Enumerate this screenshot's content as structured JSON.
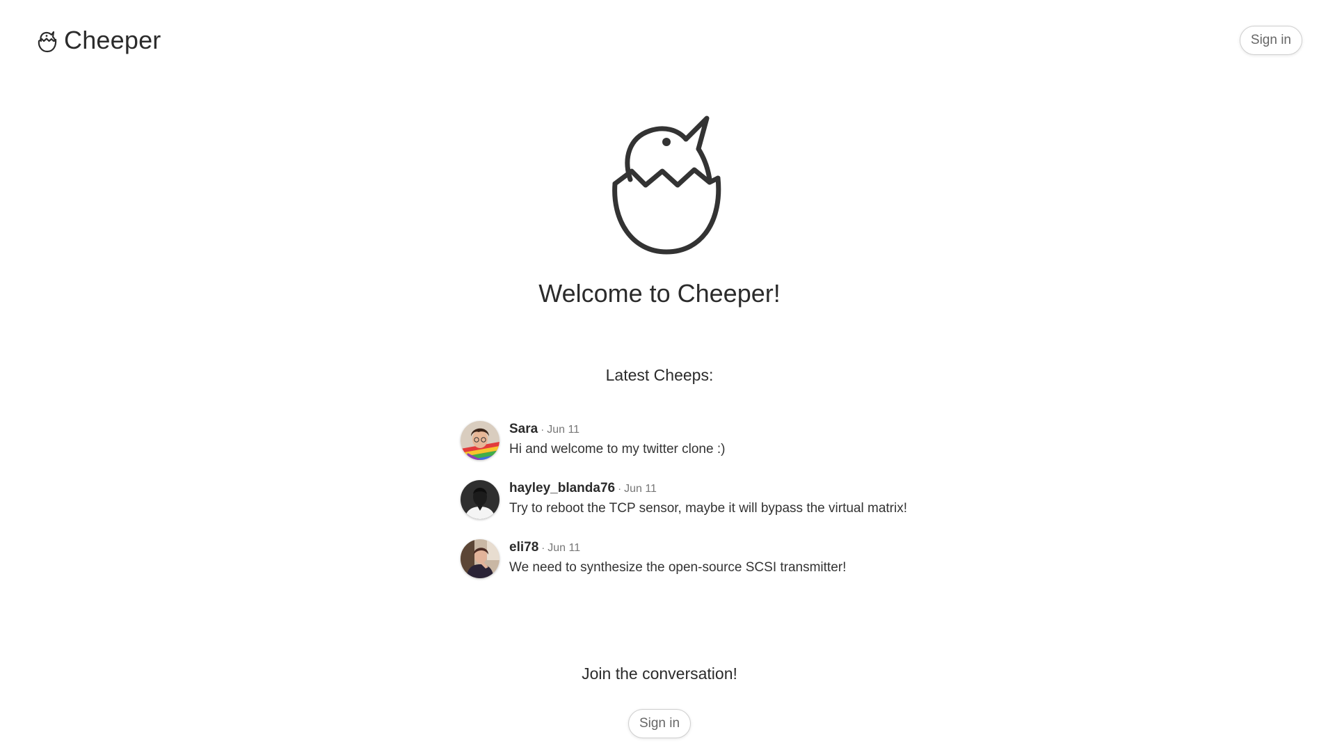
{
  "header": {
    "brand_name": "Cheeper",
    "signin_label": "Sign in"
  },
  "hero": {
    "title": "Welcome to Cheeper!"
  },
  "latest": {
    "heading": "Latest Cheeps:",
    "separator": "·",
    "cheeps": [
      {
        "username": "Sara",
        "date": "Jun 11",
        "text": "Hi and welcome to my twitter clone :)"
      },
      {
        "username": "hayley_blanda76",
        "date": "Jun 11",
        "text": "Try to reboot the TCP sensor, maybe it will bypass the virtual matrix!"
      },
      {
        "username": "eli78",
        "date": "Jun 11",
        "text": "We need to synthesize the open-source SCSI transmitter!"
      }
    ]
  },
  "join": {
    "heading": "Join the conversation!",
    "signin_label": "Sign in"
  },
  "colors": {
    "text": "#2b2b2b",
    "muted": "#777777",
    "border": "#cfcfcf",
    "background": "#ffffff"
  }
}
